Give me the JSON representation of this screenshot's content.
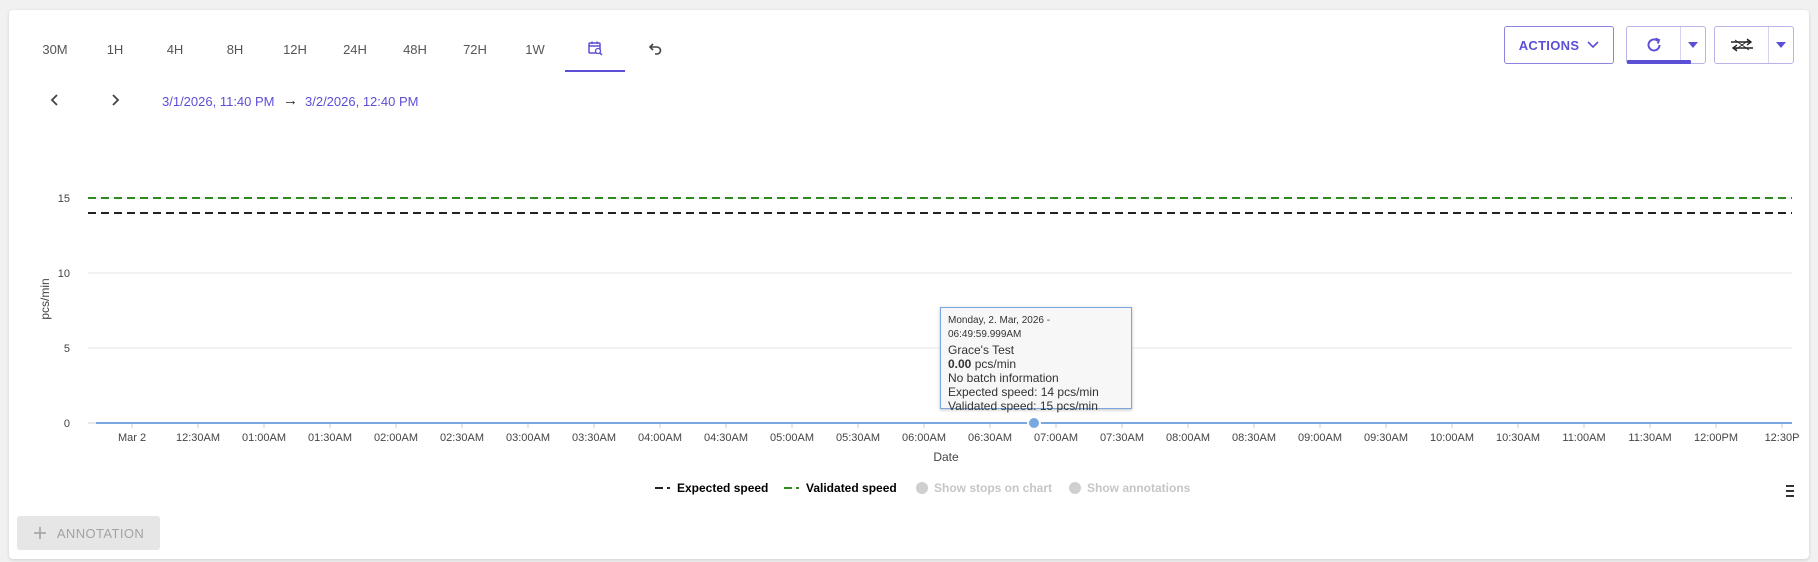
{
  "time_ranges": {
    "r30m": "30M",
    "r1h": "1H",
    "r4h": "4H",
    "r8h": "8H",
    "r12h": "12H",
    "r24h": "24H",
    "r48h": "48H",
    "r72h": "72H",
    "r1w": "1W"
  },
  "date_range": {
    "start": "3/1/2026, 11:40 PM",
    "separator": "→",
    "end": "3/2/2026, 12:40 PM"
  },
  "toolbar": {
    "actions_label": "ACTIONS"
  },
  "colors": {
    "accent": "#5b4fd6",
    "expected_line": "#222222",
    "validated_line": "#2e8b1e",
    "series_line": "#7aa7e0"
  },
  "tooltip": {
    "date": "Monday, 2. Mar, 2026 - 06:49:59.999AM",
    "series_name": "Grace's Test",
    "value_bold": "0.00",
    "value_unit": " pcs/min",
    "batch": "No batch information",
    "expected": "Expected speed: 14 pcs/min",
    "validated": "Validated speed: 15 pcs/min"
  },
  "legend": {
    "expected": "Expected speed",
    "validated": "Validated speed",
    "stops": "Show stops on chart",
    "annotations": "Show annotations"
  },
  "annotation_button": "ANNOTATION",
  "chart_data": {
    "type": "line",
    "xlabel": "Date",
    "ylabel": "pcs/min",
    "ylim": [
      0,
      15
    ],
    "y_ticks": [
      "0",
      "5",
      "10",
      "15"
    ],
    "x_ticks": [
      "Mar 2",
      "12:30AM",
      "01:00AM",
      "01:30AM",
      "02:00AM",
      "02:30AM",
      "03:00AM",
      "03:30AM",
      "04:00AM",
      "04:30AM",
      "05:00AM",
      "05:30AM",
      "06:00AM",
      "06:30AM",
      "07:00AM",
      "07:30AM",
      "08:00AM",
      "08:30AM",
      "09:00AM",
      "09:30AM",
      "10:00AM",
      "10:30AM",
      "11:00AM",
      "11:30AM",
      "12:00PM",
      "12:30P"
    ],
    "series": [
      {
        "name": "Grace's Test",
        "value": 0
      },
      {
        "name": "Expected speed",
        "value": 14
      },
      {
        "name": "Validated speed",
        "value": 15
      }
    ],
    "highlight_point": {
      "time": "06:50AM",
      "value": 0
    },
    "grid": true,
    "legend_position": "bottom"
  }
}
